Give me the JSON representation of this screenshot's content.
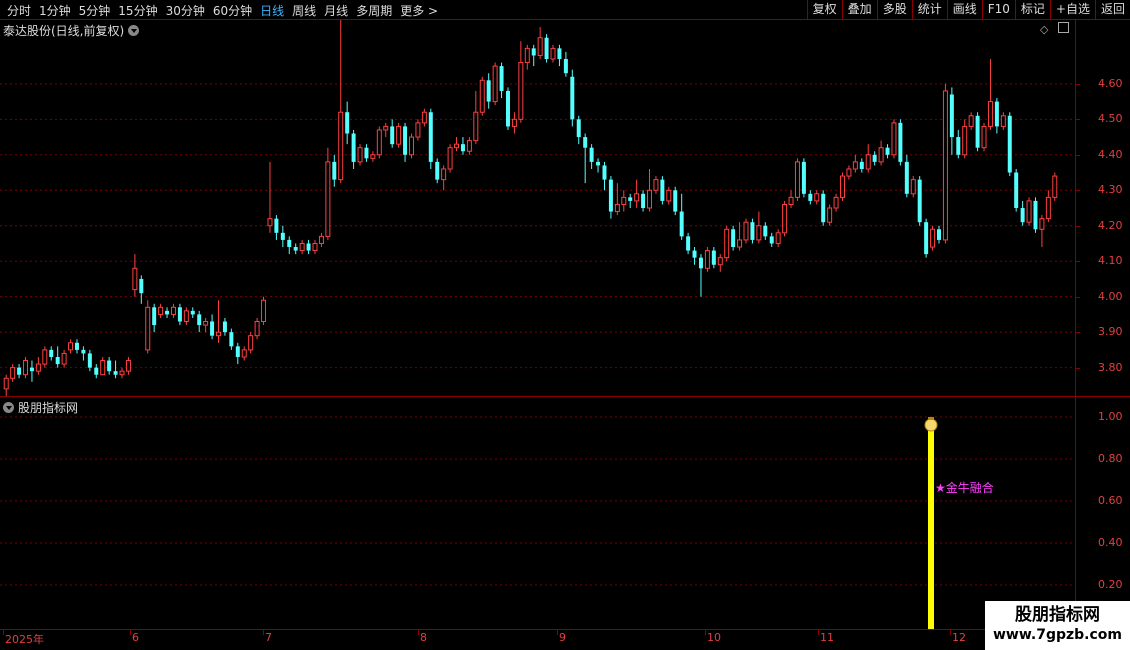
{
  "toolbar": {
    "periods": [
      "分时",
      "1分钟",
      "5分钟",
      "15分钟",
      "30分钟",
      "60分钟",
      "日线",
      "周线",
      "月线",
      "多周期",
      "更多 >"
    ],
    "active_period": "日线",
    "tools": [
      "复权",
      "叠加",
      "多股",
      "统计",
      "画线",
      "F10",
      "标记",
      "+自选",
      "返回"
    ]
  },
  "price_panel": {
    "title": "泰达股份(日线,前复权)",
    "y_labels": [
      "4.60",
      "4.50",
      "4.40",
      "4.30",
      "4.20",
      "4.10",
      "4.00",
      "3.90",
      "3.80"
    ],
    "y_values": [
      4.6,
      4.5,
      4.4,
      4.3,
      4.2,
      4.1,
      4.0,
      3.9,
      3.8
    ]
  },
  "indicator_panel": {
    "title": "股朋指标网",
    "y_labels": [
      "1.00",
      "0.80",
      "0.60",
      "0.40",
      "0.20"
    ],
    "signal_label": "★金牛融合",
    "signal_value": 1.0
  },
  "x_axis": {
    "months": [
      "2025年",
      "6",
      "7",
      "8",
      "9",
      "10",
      "11",
      "12"
    ]
  },
  "watermark": {
    "title": "股朋指标网",
    "url": "www.7gpzb.com"
  },
  "colors": {
    "up": "#ff4040",
    "down": "#54ffff",
    "signal": "#ffff00",
    "grid": "#8a0000"
  },
  "chart_data": {
    "type": "candlestick",
    "ylim": [
      3.72,
      4.78
    ],
    "candles": [
      [
        3.74,
        3.77,
        3.72,
        3.78
      ],
      [
        3.77,
        3.8,
        3.76,
        3.81
      ],
      [
        3.8,
        3.78,
        3.77,
        3.81
      ],
      [
        3.78,
        3.82,
        3.77,
        3.83
      ],
      [
        3.8,
        3.79,
        3.76,
        3.82
      ],
      [
        3.79,
        3.81,
        3.78,
        3.83
      ],
      [
        3.81,
        3.85,
        3.8,
        3.86
      ],
      [
        3.85,
        3.83,
        3.82,
        3.86
      ],
      [
        3.83,
        3.81,
        3.8,
        3.86
      ],
      [
        3.81,
        3.84,
        3.8,
        3.85
      ],
      [
        3.85,
        3.87,
        3.84,
        3.88
      ],
      [
        3.87,
        3.85,
        3.84,
        3.88
      ],
      [
        3.85,
        3.84,
        3.82,
        3.86
      ],
      [
        3.84,
        3.8,
        3.79,
        3.85
      ],
      [
        3.8,
        3.78,
        3.77,
        3.81
      ],
      [
        3.78,
        3.82,
        3.78,
        3.83
      ],
      [
        3.82,
        3.79,
        3.78,
        3.83
      ],
      [
        3.79,
        3.78,
        3.77,
        3.82
      ],
      [
        3.78,
        3.79,
        3.77,
        3.8
      ],
      [
        3.79,
        3.82,
        3.78,
        3.83
      ],
      [
        4.02,
        4.08,
        4.0,
        4.12
      ],
      [
        4.05,
        4.01,
        3.98,
        4.06
      ],
      [
        3.85,
        3.97,
        3.84,
        3.99
      ],
      [
        3.97,
        3.92,
        3.9,
        3.98
      ],
      [
        3.95,
        3.97,
        3.94,
        3.98
      ],
      [
        3.96,
        3.95,
        3.94,
        3.97
      ],
      [
        3.95,
        3.97,
        3.94,
        3.98
      ],
      [
        3.97,
        3.93,
        3.92,
        3.98
      ],
      [
        3.93,
        3.96,
        3.92,
        3.97
      ],
      [
        3.96,
        3.95,
        3.94,
        3.97
      ],
      [
        3.95,
        3.92,
        3.9,
        3.96
      ],
      [
        3.92,
        3.93,
        3.9,
        3.94
      ],
      [
        3.93,
        3.89,
        3.88,
        3.95
      ],
      [
        3.89,
        3.9,
        3.87,
        3.99
      ],
      [
        3.93,
        3.9,
        3.89,
        3.94
      ],
      [
        3.9,
        3.86,
        3.85,
        3.91
      ],
      [
        3.86,
        3.83,
        3.81,
        3.87
      ],
      [
        3.83,
        3.85,
        3.82,
        3.86
      ],
      [
        3.85,
        3.89,
        3.84,
        3.9
      ],
      [
        3.89,
        3.93,
        3.88,
        3.94
      ],
      [
        3.93,
        3.99,
        3.92,
        4.0
      ],
      [
        4.2,
        4.22,
        4.18,
        4.38
      ],
      [
        4.22,
        4.18,
        4.16,
        4.23
      ],
      [
        4.18,
        4.16,
        4.14,
        4.2
      ],
      [
        4.16,
        4.14,
        4.12,
        4.17
      ],
      [
        4.14,
        4.13,
        4.12,
        4.15
      ],
      [
        4.13,
        4.15,
        4.12,
        4.16
      ],
      [
        4.15,
        4.13,
        4.12,
        4.16
      ],
      [
        4.13,
        4.15,
        4.12,
        4.16
      ],
      [
        4.15,
        4.17,
        4.14,
        4.18
      ],
      [
        4.17,
        4.38,
        4.16,
        4.42
      ],
      [
        4.38,
        4.33,
        4.31,
        4.4
      ],
      [
        4.33,
        4.52,
        4.32,
        4.78
      ],
      [
        4.52,
        4.46,
        4.43,
        4.55
      ],
      [
        4.46,
        4.38,
        4.36,
        4.47
      ],
      [
        4.38,
        4.42,
        4.37,
        4.43
      ],
      [
        4.42,
        4.39,
        4.38,
        4.43
      ],
      [
        4.39,
        4.4,
        4.38,
        4.41
      ],
      [
        4.4,
        4.47,
        4.39,
        4.48
      ],
      [
        4.47,
        4.48,
        4.45,
        4.49
      ],
      [
        4.48,
        4.43,
        4.42,
        4.5
      ],
      [
        4.43,
        4.48,
        4.42,
        4.49
      ],
      [
        4.48,
        4.4,
        4.38,
        4.49
      ],
      [
        4.4,
        4.45,
        4.39,
        4.46
      ],
      [
        4.45,
        4.49,
        4.44,
        4.5
      ],
      [
        4.49,
        4.52,
        4.48,
        4.53
      ],
      [
        4.52,
        4.38,
        4.36,
        4.53
      ],
      [
        4.38,
        4.33,
        4.32,
        4.39
      ],
      [
        4.33,
        4.36,
        4.3,
        4.37
      ],
      [
        4.36,
        4.42,
        4.35,
        4.43
      ],
      [
        4.42,
        4.43,
        4.41,
        4.45
      ],
      [
        4.43,
        4.41,
        4.4,
        4.45
      ],
      [
        4.41,
        4.44,
        4.4,
        4.45
      ],
      [
        4.44,
        4.52,
        4.43,
        4.58
      ],
      [
        4.52,
        4.61,
        4.51,
        4.62
      ],
      [
        4.61,
        4.55,
        4.53,
        4.63
      ],
      [
        4.55,
        4.65,
        4.54,
        4.66
      ],
      [
        4.65,
        4.58,
        4.56,
        4.66
      ],
      [
        4.58,
        4.48,
        4.47,
        4.59
      ],
      [
        4.48,
        4.5,
        4.46,
        4.52
      ],
      [
        4.5,
        4.66,
        4.49,
        4.72
      ],
      [
        4.66,
        4.7,
        4.64,
        4.71
      ],
      [
        4.7,
        4.68,
        4.65,
        4.71
      ],
      [
        4.68,
        4.73,
        4.67,
        4.76
      ],
      [
        4.73,
        4.67,
        4.66,
        4.74
      ],
      [
        4.67,
        4.7,
        4.66,
        4.71
      ],
      [
        4.7,
        4.67,
        4.65,
        4.71
      ],
      [
        4.67,
        4.63,
        4.62,
        4.69
      ],
      [
        4.62,
        4.5,
        4.48,
        4.64
      ],
      [
        4.5,
        4.45,
        4.43,
        4.51
      ],
      [
        4.45,
        4.42,
        4.32,
        4.46
      ],
      [
        4.42,
        4.38,
        4.36,
        4.43
      ],
      [
        4.38,
        4.37,
        4.35,
        4.39
      ],
      [
        4.37,
        4.33,
        4.3,
        4.38
      ],
      [
        4.33,
        4.24,
        4.22,
        4.34
      ],
      [
        4.24,
        4.26,
        4.23,
        4.32
      ],
      [
        4.26,
        4.28,
        4.24,
        4.3
      ],
      [
        4.28,
        4.27,
        4.25,
        4.29
      ],
      [
        4.27,
        4.29,
        4.25,
        4.33
      ],
      [
        4.29,
        4.25,
        4.24,
        4.3
      ],
      [
        4.25,
        4.3,
        4.24,
        4.36
      ],
      [
        4.3,
        4.33,
        4.29,
        4.34
      ],
      [
        4.33,
        4.27,
        4.26,
        4.34
      ],
      [
        4.27,
        4.3,
        4.26,
        4.31
      ],
      [
        4.3,
        4.24,
        4.23,
        4.31
      ],
      [
        4.24,
        4.17,
        4.16,
        4.29
      ],
      [
        4.17,
        4.13,
        4.12,
        4.18
      ],
      [
        4.13,
        4.11,
        4.09,
        4.14
      ],
      [
        4.11,
        4.08,
        4.0,
        4.12
      ],
      [
        4.08,
        4.13,
        4.07,
        4.14
      ],
      [
        4.13,
        4.09,
        4.08,
        4.14
      ],
      [
        4.09,
        4.11,
        4.07,
        4.12
      ],
      [
        4.11,
        4.19,
        4.1,
        4.2
      ],
      [
        4.19,
        4.14,
        4.13,
        4.2
      ],
      [
        4.14,
        4.16,
        4.13,
        4.21
      ],
      [
        4.16,
        4.21,
        4.15,
        4.22
      ],
      [
        4.21,
        4.16,
        4.15,
        4.22
      ],
      [
        4.16,
        4.2,
        4.15,
        4.24
      ],
      [
        4.2,
        4.17,
        4.16,
        4.21
      ],
      [
        4.17,
        4.15,
        4.14,
        4.18
      ],
      [
        4.15,
        4.18,
        4.14,
        4.19
      ],
      [
        4.18,
        4.26,
        4.17,
        4.27
      ],
      [
        4.26,
        4.28,
        4.25,
        4.3
      ],
      [
        4.28,
        4.38,
        4.27,
        4.39
      ],
      [
        4.38,
        4.29,
        4.28,
        4.39
      ],
      [
        4.29,
        4.27,
        4.26,
        4.3
      ],
      [
        4.27,
        4.29,
        4.26,
        4.3
      ],
      [
        4.29,
        4.21,
        4.2,
        4.3
      ],
      [
        4.21,
        4.25,
        4.2,
        4.26
      ],
      [
        4.25,
        4.28,
        4.24,
        4.29
      ],
      [
        4.28,
        4.34,
        4.27,
        4.35
      ],
      [
        4.34,
        4.36,
        4.33,
        4.37
      ],
      [
        4.36,
        4.38,
        4.35,
        4.4
      ],
      [
        4.38,
        4.36,
        4.35,
        4.39
      ],
      [
        4.36,
        4.4,
        4.35,
        4.43
      ],
      [
        4.4,
        4.38,
        4.37,
        4.41
      ],
      [
        4.38,
        4.42,
        4.37,
        4.44
      ],
      [
        4.42,
        4.4,
        4.39,
        4.43
      ],
      [
        4.4,
        4.49,
        4.39,
        4.5
      ],
      [
        4.49,
        4.38,
        4.37,
        4.5
      ],
      [
        4.38,
        4.29,
        4.28,
        4.4
      ],
      [
        4.29,
        4.33,
        4.28,
        4.34
      ],
      [
        4.33,
        4.21,
        4.2,
        4.34
      ],
      [
        4.21,
        4.12,
        4.11,
        4.22
      ],
      [
        4.14,
        4.19,
        4.13,
        4.2
      ],
      [
        4.19,
        4.16,
        4.15,
        4.2
      ],
      [
        4.16,
        4.58,
        4.15,
        4.6
      ],
      [
        4.57,
        4.45,
        4.4,
        4.59
      ],
      [
        4.45,
        4.4,
        4.39,
        4.47
      ],
      [
        4.4,
        4.48,
        4.39,
        4.5
      ],
      [
        4.48,
        4.51,
        4.47,
        4.52
      ],
      [
        4.51,
        4.42,
        4.41,
        4.52
      ],
      [
        4.42,
        4.48,
        4.41,
        4.49
      ],
      [
        4.48,
        4.55,
        4.47,
        4.67
      ],
      [
        4.55,
        4.48,
        4.46,
        4.56
      ],
      [
        4.48,
        4.51,
        4.47,
        4.52
      ],
      [
        4.51,
        4.35,
        4.34,
        4.52
      ],
      [
        4.35,
        4.25,
        4.24,
        4.36
      ],
      [
        4.25,
        4.21,
        4.2,
        4.27
      ],
      [
        4.21,
        4.27,
        4.2,
        4.28
      ],
      [
        4.27,
        4.19,
        4.18,
        4.28
      ],
      [
        4.19,
        4.22,
        4.14,
        4.23
      ],
      [
        4.22,
        4.28,
        4.21,
        4.3
      ],
      [
        4.28,
        4.34,
        4.27,
        4.35
      ]
    ]
  }
}
